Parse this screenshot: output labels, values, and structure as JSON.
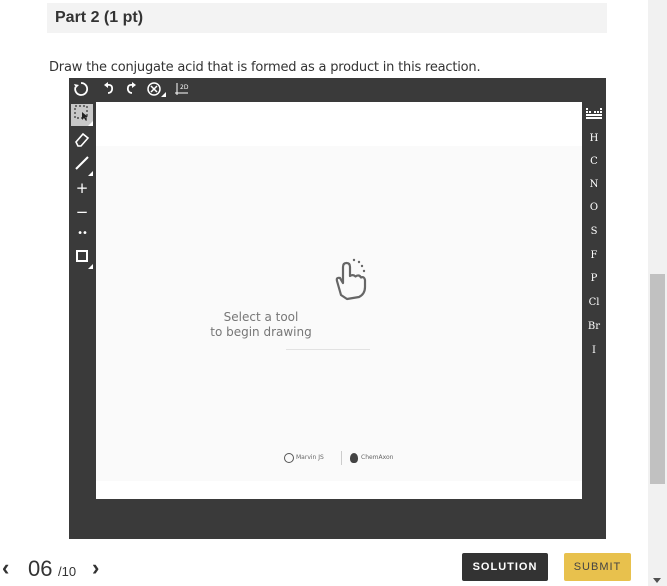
{
  "part": {
    "title": "Part 2 (1 pt)"
  },
  "question": {
    "text": "Draw the conjugate acid that is formed as a product in this reaction."
  },
  "editor": {
    "top_toolbar": [
      {
        "name": "clear-icon",
        "glyph": "⟳"
      },
      {
        "name": "undo-icon",
        "glyph": "↶"
      },
      {
        "name": "redo-icon",
        "glyph": "↷"
      },
      {
        "name": "zoom-icon",
        "glyph": "⊗"
      },
      {
        "name": "2d-clean-icon",
        "glyph": "2D"
      }
    ],
    "left_tools": [
      {
        "name": "select-tool-icon",
        "glyph": "⬚"
      },
      {
        "name": "eraser-tool-icon",
        "glyph": "⌫"
      },
      {
        "name": "bond-tool-icon",
        "glyph": "/"
      },
      {
        "name": "positive-charge-icon",
        "glyph": "+"
      },
      {
        "name": "negative-charge-icon",
        "glyph": "−"
      },
      {
        "name": "lone-pair-icon",
        "glyph": "••"
      },
      {
        "name": "ring-tool-icon",
        "glyph": "▢"
      }
    ],
    "hint_line1": "Select a tool",
    "hint_line2": "to begin drawing",
    "logo_marvin": "Marvin JS",
    "logo_chemaxon": "ChemAxon",
    "elements": [
      "H",
      "C",
      "N",
      "O",
      "S",
      "F",
      "P",
      "Cl",
      "Br",
      "I"
    ]
  },
  "nav": {
    "prev": "‹",
    "current": "06",
    "total": "/10",
    "next": "›"
  },
  "buttons": {
    "solution": "SOLUTION",
    "submit": "SUBMIT"
  },
  "colors": {
    "editor_bg": "#3a3a3a",
    "submit_bg": "#e8c14d",
    "solution_bg": "#333333"
  }
}
